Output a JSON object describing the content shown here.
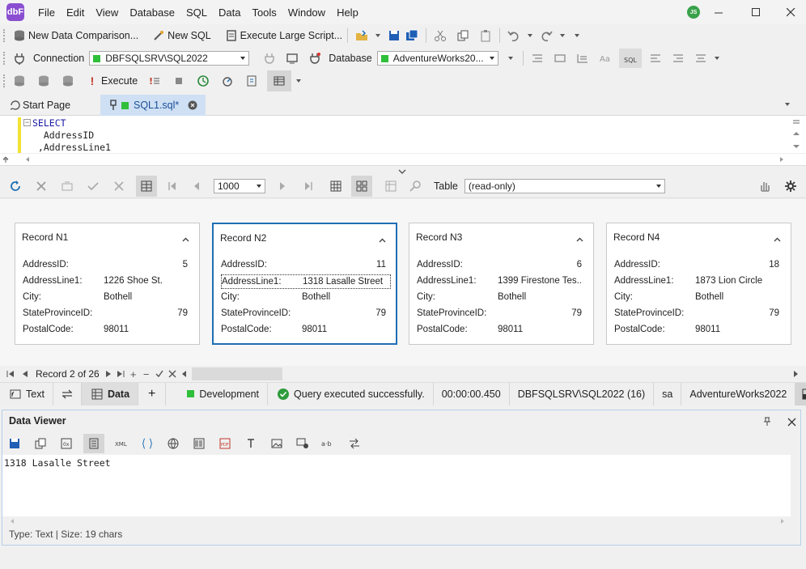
{
  "app": {
    "logo_text": "dbF",
    "avatar_initials": "JS"
  },
  "menu": [
    "File",
    "Edit",
    "View",
    "Database",
    "SQL",
    "Data",
    "Tools",
    "Window",
    "Help"
  ],
  "toolbar1": {
    "new_data_comparison": "New Data Comparison...",
    "new_sql": "New SQL",
    "execute_large_script": "Execute Large Script..."
  },
  "toolbar2": {
    "connection_label": "Connection",
    "connection_value": "DBFSQLSRV\\SQL2022",
    "database_label": "Database",
    "database_value": "AdventureWorks20..."
  },
  "toolbar3": {
    "execute": "Execute"
  },
  "tabs": {
    "start_page": "Start Page",
    "sql1": "SQL1.sql*"
  },
  "editor": {
    "lines": [
      "SELECT",
      "  AddressID",
      " ,AddressLine1"
    ]
  },
  "grid_toolbar": {
    "page_size": "1000",
    "view_label": "Table",
    "view_value": "(read-only)"
  },
  "records": [
    {
      "title": "Record N1",
      "fields": [
        {
          "k": "AddressID:",
          "v": "",
          "n": "5"
        },
        {
          "k": "AddressLine1:",
          "v": "1226 Shoe St.",
          "n": ""
        },
        {
          "k": "City:",
          "v": "Bothell",
          "n": ""
        },
        {
          "k": "StateProvinceID:",
          "v": "",
          "n": "79"
        },
        {
          "k": "PostalCode:",
          "v": "98011",
          "n": ""
        }
      ]
    },
    {
      "title": "Record N2",
      "fields": [
        {
          "k": "AddressID:",
          "v": "",
          "n": "11"
        },
        {
          "k": "AddressLine1:",
          "v": "1318 Lasalle Street",
          "n": ""
        },
        {
          "k": "City:",
          "v": "Bothell",
          "n": ""
        },
        {
          "k": "StateProvinceID:",
          "v": "",
          "n": "79"
        },
        {
          "k": "PostalCode:",
          "v": "98011",
          "n": ""
        }
      ]
    },
    {
      "title": "Record N3",
      "fields": [
        {
          "k": "AddressID:",
          "v": "",
          "n": "6"
        },
        {
          "k": "AddressLine1:",
          "v": "1399 Firestone Tes...",
          "n": ""
        },
        {
          "k": "City:",
          "v": "Bothell",
          "n": ""
        },
        {
          "k": "StateProvinceID:",
          "v": "",
          "n": "79"
        },
        {
          "k": "PostalCode:",
          "v": "98011",
          "n": ""
        }
      ]
    },
    {
      "title": "Record N4",
      "fields": [
        {
          "k": "AddressID:",
          "v": "",
          "n": "18"
        },
        {
          "k": "AddressLine1:",
          "v": "1873 Lion Circle",
          "n": ""
        },
        {
          "k": "City:",
          "v": "Bothell",
          "n": ""
        },
        {
          "k": "StateProvinceID:",
          "v": "",
          "n": "79"
        },
        {
          "k": "PostalCode:",
          "v": "98011",
          "n": ""
        }
      ]
    }
  ],
  "navigation": {
    "record_label": "Record 2 of 26"
  },
  "status": {
    "text_tab": "Text",
    "data_tab": "Data",
    "environment": "Development",
    "message": "Query executed successfully.",
    "elapsed": "00:00:00.450",
    "server": "DBFSQLSRV\\SQL2022 (16)",
    "user": "sa",
    "database": "AdventureWorks2022"
  },
  "viewer": {
    "title": "Data Viewer",
    "content": "1318 Lasalle Street",
    "info": "Type: Text | Size: 19 chars"
  },
  "colors": {
    "accent": "#1f6fb5",
    "green": "#2fbf3a",
    "logo": "#8a4fd1"
  }
}
